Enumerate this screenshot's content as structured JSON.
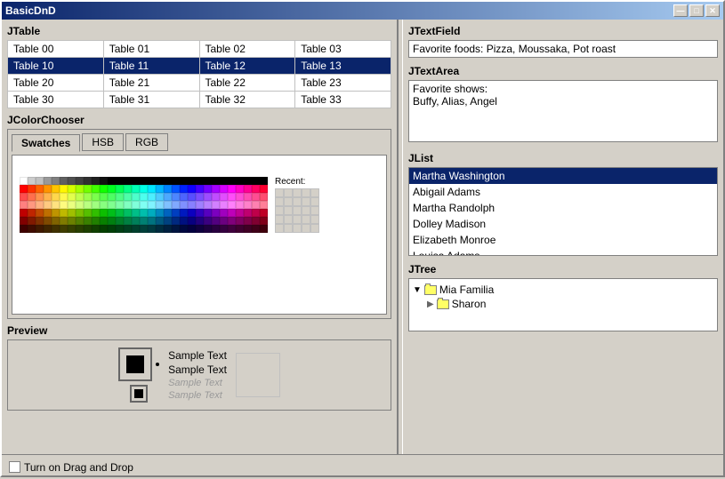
{
  "window": {
    "title": "BasicDnD",
    "buttons": [
      "minimize",
      "maximize",
      "close"
    ]
  },
  "jtable": {
    "label": "JTable",
    "rows": [
      [
        "Table 00",
        "Table 01",
        "Table 02",
        "Table 03"
      ],
      [
        "Table 10",
        "Table 11",
        "Table 12",
        "Table 13"
      ],
      [
        "Table 20",
        "Table 21",
        "Table 22",
        "Table 23"
      ],
      [
        "Table 30",
        "Table 31",
        "Table 32",
        "Table 33"
      ]
    ],
    "selected_row": 1
  },
  "jcolorchooser": {
    "label": "JColorChooser",
    "tabs": [
      "Swatches",
      "HSB",
      "RGB"
    ],
    "active_tab": "Swatches",
    "recent_label": "Recent:"
  },
  "preview": {
    "label": "Preview",
    "sample_text": "Sample Text",
    "sample_text2": "Sample Text",
    "sample_italic": "Sample Text",
    "sample_italic2": "Sample Text"
  },
  "jtextfield": {
    "label": "JTextField",
    "value": "Favorite foods: Pizza, Moussaka, Pot roast"
  },
  "jtextarea": {
    "label": "JTextArea",
    "value": "Favorite shows:\nBuffy, Alias, Angel"
  },
  "jlist": {
    "label": "JList",
    "items": [
      "Martha Washington",
      "Abigail Adams",
      "Martha Randolph",
      "Dolley Madison",
      "Elizabeth Monroe",
      "Louisa Adams"
    ],
    "selected": "Martha Washington"
  },
  "jtree": {
    "label": "JTree",
    "items": [
      {
        "label": "Mia Familia",
        "type": "folder",
        "children": [
          {
            "label": "Sharon",
            "type": "folder"
          }
        ]
      }
    ]
  },
  "bottom": {
    "checkbox_label": "Turn on Drag and Drop"
  }
}
